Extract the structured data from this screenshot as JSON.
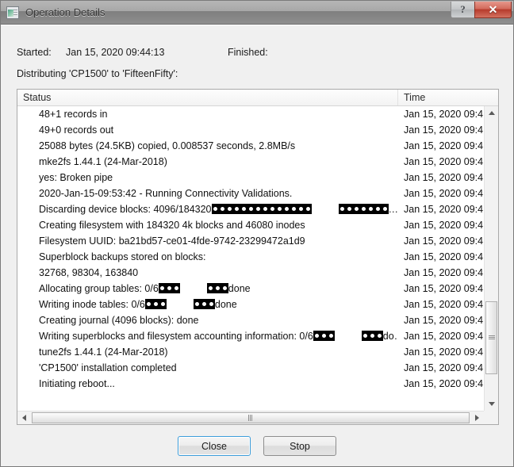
{
  "window": {
    "title": "Operation Details",
    "icon": "application-window-icon",
    "caption_buttons": {
      "help_label": "?",
      "close_label": "✕"
    }
  },
  "header": {
    "started_label": "Started:",
    "started_value": "Jan 15, 2020  09:44:13",
    "finished_label": "Finished:",
    "finished_value": "",
    "distributing": "Distributing 'CP1500' to 'FifteenFifty':"
  },
  "list": {
    "columns": [
      "Status",
      "Time"
    ],
    "rows": [
      {
        "status": "48+1 records in",
        "time": "Jan 15, 2020  09:4"
      },
      {
        "status": "49+0 records out",
        "time": "Jan 15, 2020  09:4"
      },
      {
        "status": "25088 bytes (24.5KB) copied, 0.008537 seconds, 2.8MB/s",
        "time": "Jan 15, 2020  09:4"
      },
      {
        "status": "mke2fs 1.44.1 (24-Mar-2018)",
        "time": "Jan 15, 2020  09:4"
      },
      {
        "status": "yes: Broken pipe",
        "time": "Jan 15, 2020  09:4"
      },
      {
        "status": "2020-Jan-15-09:53:42 - Running Connectivity Validations.",
        "time": "Jan 15, 2020  09:4"
      },
      {
        "status": "Discarding device blocks:   4096/184320",
        "status_suffix": "",
        "tofu_pattern": "14|gap|7|ellipsis",
        "time": "Jan 15, 2020  09:4"
      },
      {
        "status": "Creating filesystem with 184320 4k blocks and 46080 inodes",
        "time": "Jan 15, 2020  09:4"
      },
      {
        "status": "Filesystem UUID: ba21bd57-ce01-4fde-9742-23299472a1d9",
        "time": "Jan 15, 2020  09:4"
      },
      {
        "status": "Superblock backups stored on blocks:",
        "time": "Jan 15, 2020  09:4"
      },
      {
        "status": "32768, 98304, 163840",
        "time": "Jan 15, 2020  09:4"
      },
      {
        "status": "Allocating group tables: 0/6",
        "status_suffix": "done",
        "tofu_pattern": "3|gap|3",
        "time": "Jan 15, 2020  09:4"
      },
      {
        "status": "Writing inode tables: 0/6",
        "status_suffix": "done",
        "tofu_pattern": "3|gap|3",
        "time": "Jan 15, 2020  09:4"
      },
      {
        "status": "Creating journal (4096 blocks): done",
        "time": "Jan 15, 2020  09:4"
      },
      {
        "status": "Writing superblocks and filesystem accounting information: 0/6",
        "status_suffix": "do…",
        "tofu_pattern": "3|gap|3",
        "time": "Jan 15, 2020  09:4"
      },
      {
        "status": "tune2fs 1.44.1 (24-Mar-2018)",
        "time": "Jan 15, 2020  09:4"
      },
      {
        "status": "'CP1500' installation completed",
        "time": "Jan 15, 2020  09:4"
      },
      {
        "status": "Initiating reboot...",
        "time": "Jan 15, 2020  09:4"
      }
    ]
  },
  "footer": {
    "close_label": "Close",
    "stop_label": "Stop"
  },
  "scrollbars": {
    "vertical_thumb_top_pct": 65,
    "vertical_thumb_height_pct": 26,
    "horizontal_thumb_present": true
  }
}
